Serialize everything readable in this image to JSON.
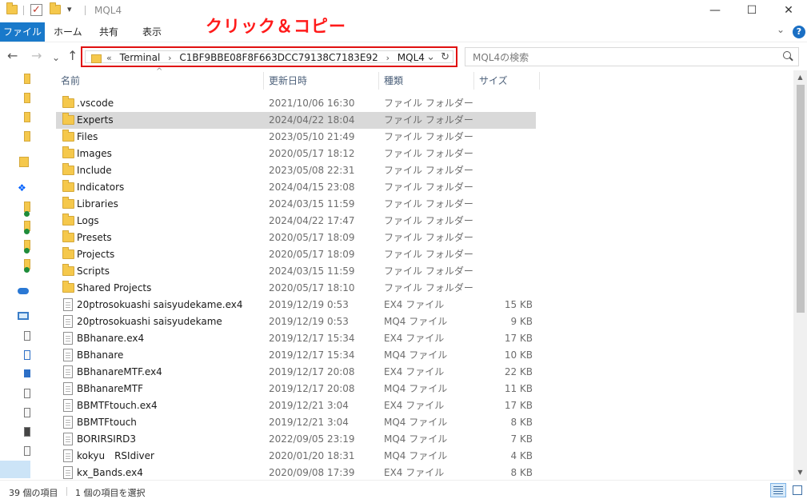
{
  "window": {
    "title": "MQL4",
    "dropdown_glyph": "▾",
    "minimize": "—",
    "maximize": "☐",
    "close": "✕"
  },
  "ribbon": {
    "tabs": [
      "ファイル",
      "ホーム",
      "共有",
      "表示"
    ],
    "collapse_glyph": "⌄",
    "help_glyph": "?"
  },
  "annotation": "クリック＆コピー",
  "nav": {
    "back": "←",
    "forward": "→",
    "recent": "⌄",
    "up": "↑"
  },
  "address": {
    "overflow": "«",
    "crumbs": [
      "Terminal",
      "C1BF9BBE08F8F663DCC79138C7183E92",
      "MQL4"
    ],
    "separator": "›",
    "dropdown": "⌄",
    "refresh": "↻"
  },
  "search": {
    "placeholder": "MQL4の検索"
  },
  "columns": {
    "name": "名前",
    "date": "更新日時",
    "type": "種類",
    "size": "サイズ",
    "sort_glyph": "^"
  },
  "files": [
    {
      "name": ".vscode",
      "date": "2021/10/06 16:30",
      "type": "ファイル フォルダー",
      "size": "",
      "kind": "folder"
    },
    {
      "name": "Experts",
      "date": "2024/04/22 18:04",
      "type": "ファイル フォルダー",
      "size": "",
      "kind": "folder",
      "selected": true
    },
    {
      "name": "Files",
      "date": "2023/05/10 21:49",
      "type": "ファイル フォルダー",
      "size": "",
      "kind": "folder"
    },
    {
      "name": "Images",
      "date": "2020/05/17 18:12",
      "type": "ファイル フォルダー",
      "size": "",
      "kind": "folder"
    },
    {
      "name": "Include",
      "date": "2023/05/08 22:31",
      "type": "ファイル フォルダー",
      "size": "",
      "kind": "folder"
    },
    {
      "name": "Indicators",
      "date": "2024/04/15 23:08",
      "type": "ファイル フォルダー",
      "size": "",
      "kind": "folder"
    },
    {
      "name": "Libraries",
      "date": "2024/03/15 11:59",
      "type": "ファイル フォルダー",
      "size": "",
      "kind": "folder"
    },
    {
      "name": "Logs",
      "date": "2024/04/22 17:47",
      "type": "ファイル フォルダー",
      "size": "",
      "kind": "folder"
    },
    {
      "name": "Presets",
      "date": "2020/05/17 18:09",
      "type": "ファイル フォルダー",
      "size": "",
      "kind": "folder"
    },
    {
      "name": "Projects",
      "date": "2020/05/17 18:09",
      "type": "ファイル フォルダー",
      "size": "",
      "kind": "folder"
    },
    {
      "name": "Scripts",
      "date": "2024/03/15 11:59",
      "type": "ファイル フォルダー",
      "size": "",
      "kind": "folder"
    },
    {
      "name": "Shared Projects",
      "date": "2020/05/17 18:10",
      "type": "ファイル フォルダー",
      "size": "",
      "kind": "folder"
    },
    {
      "name": "20ptrosokuashi saisyudekame.ex4",
      "date": "2019/12/19 0:53",
      "type": "EX4 ファイル",
      "size": "15 KB",
      "kind": "file"
    },
    {
      "name": "20ptrosokuashi saisyudekame",
      "date": "2019/12/19 0:53",
      "type": "MQ4 ファイル",
      "size": "9 KB",
      "kind": "file"
    },
    {
      "name": "BBhanare.ex4",
      "date": "2019/12/17 15:34",
      "type": "EX4 ファイル",
      "size": "17 KB",
      "kind": "file"
    },
    {
      "name": "BBhanare",
      "date": "2019/12/17 15:34",
      "type": "MQ4 ファイル",
      "size": "10 KB",
      "kind": "file"
    },
    {
      "name": "BBhanareMTF.ex4",
      "date": "2019/12/17 20:08",
      "type": "EX4 ファイル",
      "size": "22 KB",
      "kind": "file"
    },
    {
      "name": "BBhanareMTF",
      "date": "2019/12/17 20:08",
      "type": "MQ4 ファイル",
      "size": "11 KB",
      "kind": "file"
    },
    {
      "name": "BBMTFtouch.ex4",
      "date": "2019/12/21 3:04",
      "type": "EX4 ファイル",
      "size": "17 KB",
      "kind": "file"
    },
    {
      "name": "BBMTFtouch",
      "date": "2019/12/21 3:04",
      "type": "MQ4 ファイル",
      "size": "8 KB",
      "kind": "file"
    },
    {
      "name": "BORIRSIRD3",
      "date": "2022/09/05 23:19",
      "type": "MQ4 ファイル",
      "size": "7 KB",
      "kind": "file"
    },
    {
      "name": "kokyu　RSIdiver",
      "date": "2020/01/20 18:31",
      "type": "MQ4 ファイル",
      "size": "4 KB",
      "kind": "file"
    },
    {
      "name": "kx_Bands.ex4",
      "date": "2020/09/08 17:39",
      "type": "EX4 ファイル",
      "size": "8 KB",
      "kind": "file"
    }
  ],
  "status": {
    "count": "39 個の項目",
    "selection": "1 個の項目を選択"
  },
  "scroll": {
    "up": "▲",
    "down": "▼"
  }
}
